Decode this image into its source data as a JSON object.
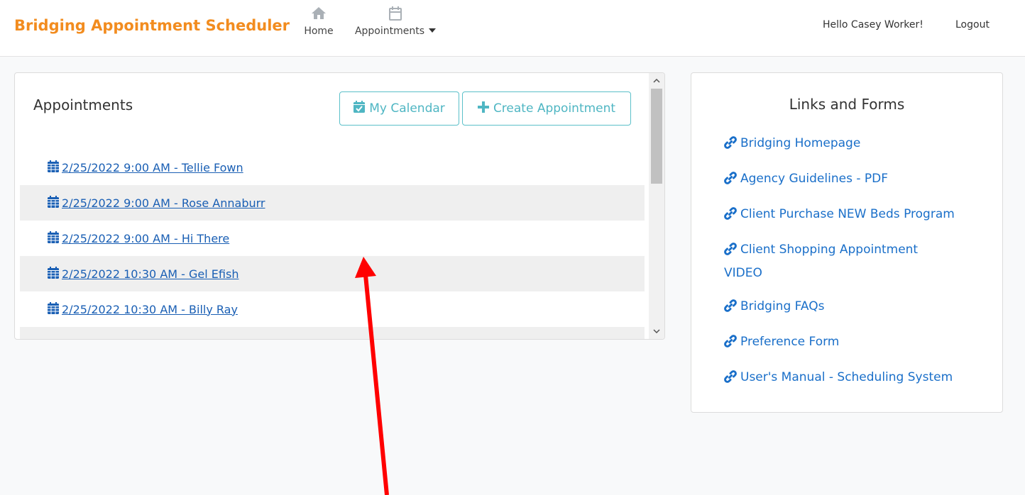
{
  "navbar": {
    "brand": "Bridging Appointment Scheduler",
    "home_label": "Home",
    "appointments_label": "Appointments",
    "greeting": "Hello Casey Worker!",
    "logout_label": "Logout"
  },
  "appointments": {
    "title": "Appointments",
    "calendar_button": "My Calendar",
    "create_button": "Create Appointment",
    "items": [
      "2/25/2022 9:00 AM - Tellie Fown",
      "2/25/2022 9:00 AM - Rose Annaburr",
      "2/25/2022 9:00 AM - Hi There",
      "2/25/2022 10:30 AM - Gel Efish",
      "2/25/2022 10:30 AM - Billy Ray"
    ]
  },
  "links": {
    "title": "Links and Forms",
    "items": [
      "Bridging Homepage",
      "Agency Guidelines - PDF",
      "Client Purchase NEW Beds Program",
      "Client Shopping Appointment VIDEO",
      "Bridging FAQs",
      "Preference Form",
      "User's Manual - Scheduling System"
    ]
  },
  "colors": {
    "brand": "#f28c1f",
    "link": "#1a6fc9",
    "button_outline": "#5bc0c9",
    "arrow": "#ff0000"
  }
}
